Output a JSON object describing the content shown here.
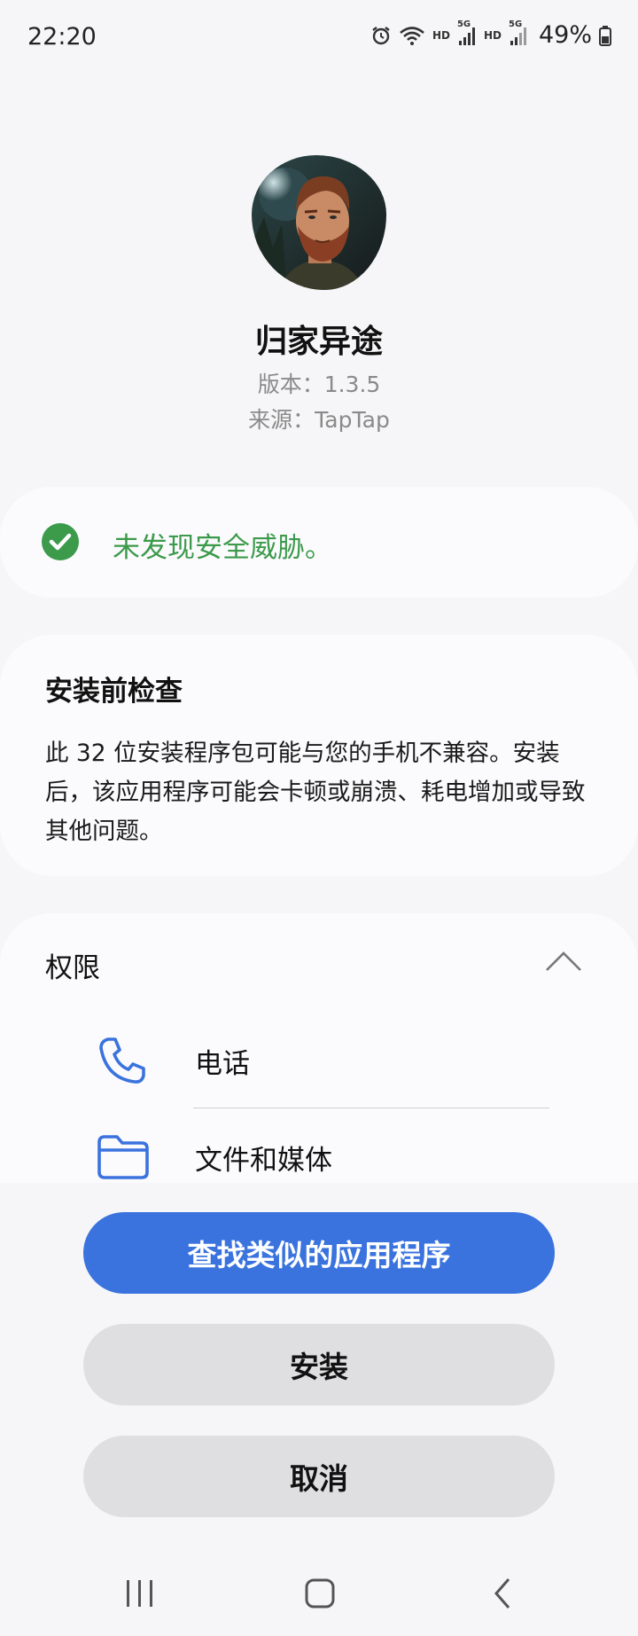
{
  "status_bar": {
    "time": "22:20",
    "hd_label_1": "HD",
    "hd_label_2": "HD",
    "net_label_1": "5G",
    "net_label_2": "5G",
    "battery": "49%",
    "icons": [
      "alarm-icon",
      "wifi-icon",
      "signal-icon",
      "signal-icon",
      "battery-icon"
    ]
  },
  "app": {
    "name": "归家异途",
    "version": "版本：1.3.5",
    "source": "来源：TapTap"
  },
  "security": {
    "message": "未发现安全威胁。",
    "accent": "#3c9a4b"
  },
  "precheck": {
    "title": "安装前检查",
    "body": "此 32 位安装程序包可能与您的手机不兼容。安装后，该应用程序可能会卡顿或崩溃、耗电增加或导致其他问题。"
  },
  "permissions": {
    "title": "权限",
    "items": [
      {
        "label": "电话",
        "icon": "phone-icon"
      },
      {
        "label": "文件和媒体",
        "icon": "folder-icon"
      }
    ],
    "icon_color": "#3a73de"
  },
  "buttons": {
    "find_similar": "查找类似的应用程序",
    "install": "安装",
    "cancel": "取消",
    "primary_color": "#3a73de"
  },
  "nav": {
    "icons": [
      "recents-icon",
      "home-icon",
      "back-icon"
    ]
  }
}
